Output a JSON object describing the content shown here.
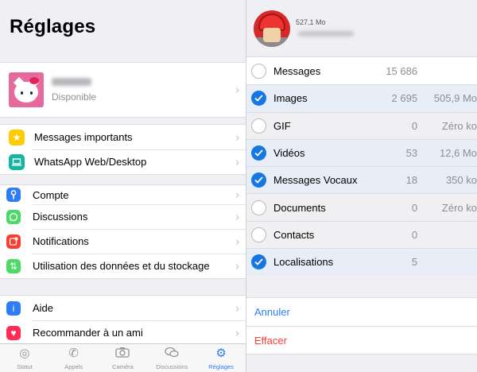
{
  "left": {
    "title": "Réglages",
    "profile": {
      "status": "Disponible"
    },
    "group1": [
      {
        "label": "Messages importants",
        "icon": "star-icon",
        "color": "#ffcc00"
      },
      {
        "label": "WhatsApp Web/Desktop",
        "icon": "laptop-icon",
        "color": "#15b5a1"
      }
    ],
    "group2": [
      {
        "label": "Compte",
        "icon": "key-icon",
        "color": "#2f7cf6"
      },
      {
        "label": "Discussions",
        "icon": "whatsapp-icon",
        "color": "#4cd964"
      },
      {
        "label": "Notifications",
        "icon": "notification-icon",
        "color": "#ff3b30"
      },
      {
        "label": "Utilisation des données et du stockage",
        "icon": "data-arrows-icon",
        "color": "#4cd964"
      }
    ],
    "group3": [
      {
        "label": "Aide",
        "icon": "info-icon",
        "color": "#2f7cf6"
      },
      {
        "label": "Recommander à un ami",
        "icon": "heart-icon",
        "color": "#ff2d55"
      }
    ],
    "tabs": [
      {
        "label": "Statut",
        "icon": "status-icon",
        "active": false
      },
      {
        "label": "Appels",
        "icon": "phone-icon",
        "active": false
      },
      {
        "label": "Caméra",
        "icon": "camera-icon",
        "active": false
      },
      {
        "label": "Discussions",
        "icon": "chat-bubbles-icon",
        "active": false
      },
      {
        "label": "Réglages",
        "icon": "gear-icon",
        "active": true
      }
    ]
  },
  "right": {
    "total_size": "527,1 Mo",
    "items": [
      {
        "name": "Messages",
        "count": "15 686",
        "size": "",
        "checked": false,
        "state": "normal"
      },
      {
        "name": "Images",
        "count": "2 695",
        "size": "505,9 Mo",
        "checked": true,
        "state": "selected"
      },
      {
        "name": "GIF",
        "count": "0",
        "size": "Zéro ko",
        "checked": false,
        "state": "disabled"
      },
      {
        "name": "Vidéos",
        "count": "53",
        "size": "12,6 Mo",
        "checked": true,
        "state": "selected"
      },
      {
        "name": "Messages Vocaux",
        "count": "18",
        "size": "350 ko",
        "checked": true,
        "state": "selected"
      },
      {
        "name": "Documents",
        "count": "0",
        "size": "Zéro ko",
        "checked": false,
        "state": "disabled"
      },
      {
        "name": "Contacts",
        "count": "0",
        "size": "",
        "checked": false,
        "state": "disabled"
      },
      {
        "name": "Localisations",
        "count": "5",
        "size": "",
        "checked": true,
        "state": "selected"
      }
    ],
    "actions": {
      "cancel": "Annuler",
      "delete": "Effacer"
    }
  },
  "colors": {
    "accent": "#2f7cf6",
    "check": "#1677e3",
    "destructive": "#ff3b30"
  }
}
